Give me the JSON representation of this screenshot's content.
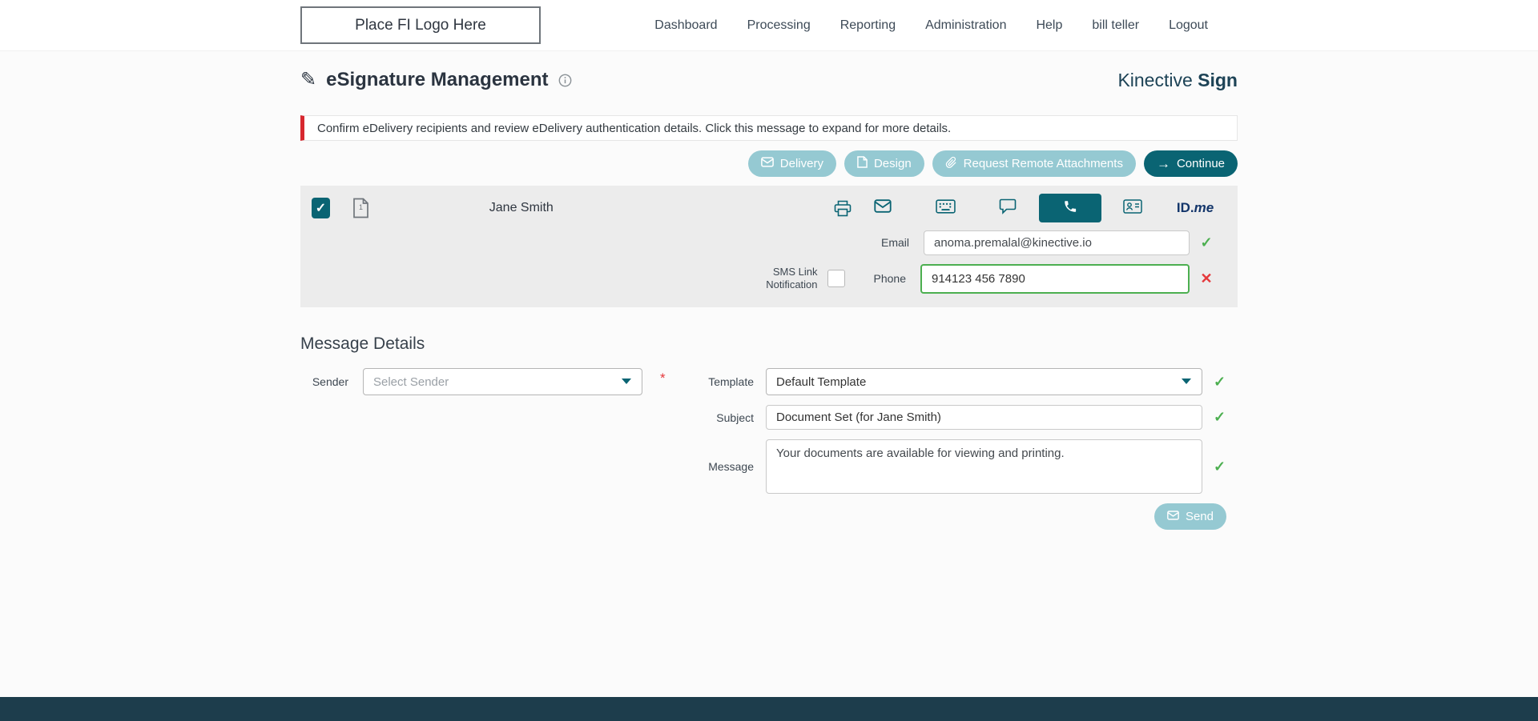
{
  "header": {
    "logo_text": "Place FI Logo Here",
    "nav": [
      {
        "label": "Dashboard"
      },
      {
        "label": "Processing"
      },
      {
        "label": "Reporting"
      },
      {
        "label": "Administration"
      },
      {
        "label": "Help"
      },
      {
        "label": "bill teller"
      },
      {
        "label": "Logout"
      }
    ]
  },
  "page": {
    "title": "eSignature Management",
    "brand_name": "Kinective",
    "brand_product": "Sign",
    "alert_text": "Confirm eDelivery recipients and review eDelivery authentication details. Click this message to expand for more details.",
    "actions": {
      "delivery": "Delivery",
      "design": "Design",
      "request_remote_attachments": "Request Remote Attachments",
      "continue_label": "Continue"
    }
  },
  "recipient": {
    "name": "Jane Smith",
    "email_label": "Email",
    "email_value": "anoma.premalal@kinective.io",
    "sms_link_label": "SMS Link Notification",
    "phone_label": "Phone",
    "phone_value": "914123 456 7890",
    "idme_id": "ID.",
    "idme_me": "me"
  },
  "message_details": {
    "heading": "Message Details",
    "sender_label": "Sender",
    "sender_placeholder": "Select Sender",
    "required_marker": "*",
    "template_label": "Template",
    "template_value": "Default Template",
    "subject_label": "Subject",
    "subject_value": "Document Set (for Jane Smith)",
    "message_label": "Message",
    "message_value": "Your documents are available for viewing and printing.",
    "send_label": "Send"
  },
  "colors": {
    "teal_dark": "#0a6473",
    "teal_light": "#95c9d2",
    "success_green": "#4caf50",
    "error_red": "#e5383b",
    "alert_red": "#d7282f",
    "brand_navy": "#1d4356",
    "footer": "#1d3d4c"
  }
}
